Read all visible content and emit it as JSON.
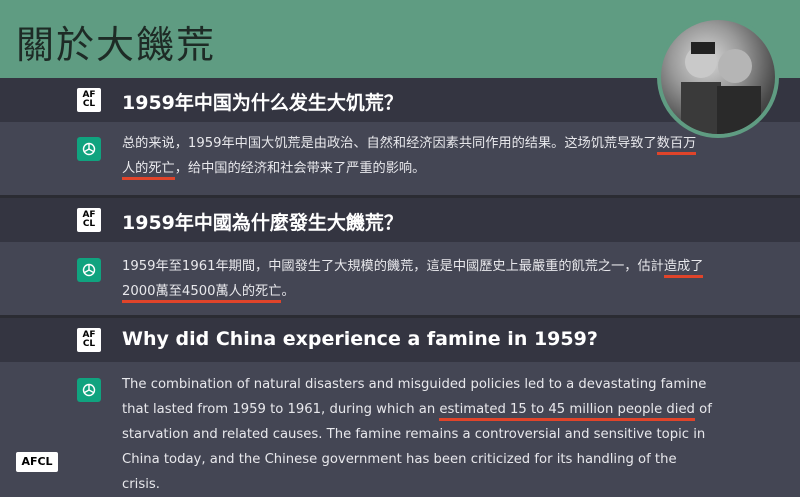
{
  "header": {
    "title": "關於大饑荒"
  },
  "qa": [
    {
      "question": "1959年中国为什么发生大饥荒？",
      "answer_pre": "总的来说，1959年中国大饥荒是由政治、自然和经济因素共同作用的结果。这场饥荒导致了",
      "answer_hl": "数百万人的死亡",
      "answer_post": "，给中国的经济和社会带来了严重的影响。"
    },
    {
      "question": "1959年中國為什麼發生大饑荒？",
      "answer_pre": "1959年至1961年期間，中國發生了大規模的饑荒，這是中國歷史上最嚴重的飢荒之一，估計",
      "answer_hl": "造成了2000萬至4500萬人的死亡",
      "answer_post": "。"
    },
    {
      "question": "Why did China experience a famine in 1959?",
      "answer_pre": "The combination of natural disasters and misguided policies led to a devastating famine that lasted from 1959 to 1961, during which an ",
      "answer_hl": "estimated 15 to 45 million people died",
      "answer_post": " of starvation and related causes. The famine remains a controversial and sensitive topic in China today, and the Chinese government has been criticized for its handling of the crisis."
    }
  ],
  "user_icon": {
    "line1": "AF",
    "line2": "CL"
  },
  "badge": "AFCL",
  "colors": {
    "header": "#5f9c82",
    "question_bg": "#343541",
    "answer_bg": "#444654",
    "highlight": "#e0442a",
    "gpt_icon": "#10a37f"
  }
}
